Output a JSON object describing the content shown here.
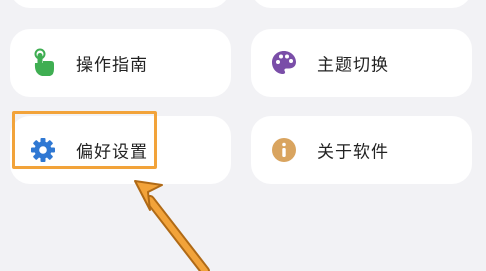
{
  "menu": {
    "items": [
      {
        "label": "操作指南",
        "icon": "touch-hand-icon"
      },
      {
        "label": "主题切换",
        "icon": "palette-icon"
      },
      {
        "label": "偏好设置",
        "icon": "gear-icon"
      },
      {
        "label": "关于软件",
        "icon": "info-icon"
      }
    ]
  },
  "colors": {
    "background": "#f2f2f5",
    "card": "#ffffff",
    "guide_icon": "#3fae52",
    "theme_icon": "#7a4ea8",
    "prefs_icon": "#2f78d3",
    "about_icon": "#d9a45f",
    "highlight": "#f2a33a"
  }
}
